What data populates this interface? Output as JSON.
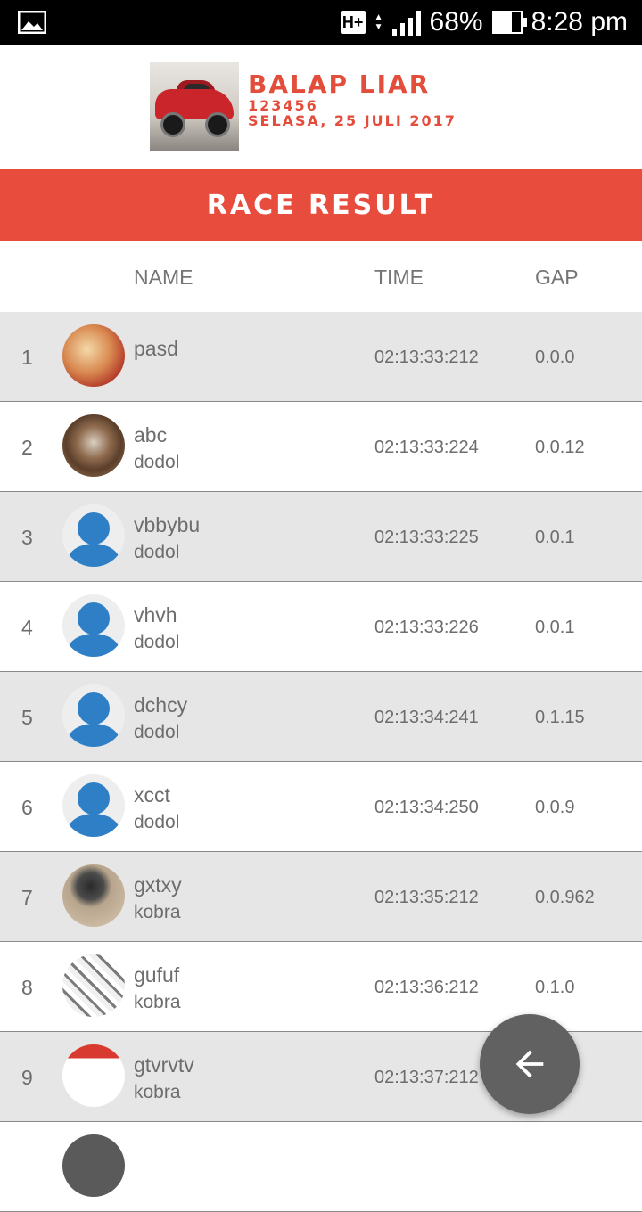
{
  "status_bar": {
    "network": "H+",
    "battery": "68%",
    "battery_level": 0.68,
    "time": "8:28 pm"
  },
  "header": {
    "title": "BALAP LIAR",
    "code": "123456",
    "date": "SELASA, 25 JULI 2017",
    "image_icon": "race-car-photo"
  },
  "banner": {
    "title": "RACE RESULT"
  },
  "columns": {
    "name": "NAME",
    "time": "TIME",
    "gap": "GAP"
  },
  "rows": [
    {
      "pos": "1",
      "name": "pasd",
      "sub": "",
      "time": "02:13:33:212",
      "gap": "0.0.0",
      "avatar": "photo1"
    },
    {
      "pos": "2",
      "name": "abc",
      "sub": "dodol",
      "time": "02:13:33:224",
      "gap": "0.0.12",
      "avatar": "photo2"
    },
    {
      "pos": "3",
      "name": "vbbybu",
      "sub": "dodol",
      "time": "02:13:33:225",
      "gap": "0.0.1",
      "avatar": "default"
    },
    {
      "pos": "4",
      "name": "vhvh",
      "sub": "dodol",
      "time": "02:13:33:226",
      "gap": "0.0.1",
      "avatar": "default"
    },
    {
      "pos": "5",
      "name": "dchcy",
      "sub": "dodol",
      "time": "02:13:34:241",
      "gap": "0.1.15",
      "avatar": "default"
    },
    {
      "pos": "6",
      "name": "xcct",
      "sub": "dodol",
      "time": "02:13:34:250",
      "gap": "0.0.9",
      "avatar": "default"
    },
    {
      "pos": "7",
      "name": "gxtxy",
      "sub": "kobra",
      "time": "02:13:35:212",
      "gap": "0.0.962",
      "avatar": "photo3"
    },
    {
      "pos": "8",
      "name": "gufuf",
      "sub": "kobra",
      "time": "02:13:36:212",
      "gap": "0.1.0",
      "avatar": "photo4"
    },
    {
      "pos": "9",
      "name": "gtvrvtv",
      "sub": "kobra",
      "time": "02:13:37:212",
      "gap": "",
      "avatar": "photo5"
    }
  ],
  "fab": {
    "icon": "arrow-back-icon"
  }
}
